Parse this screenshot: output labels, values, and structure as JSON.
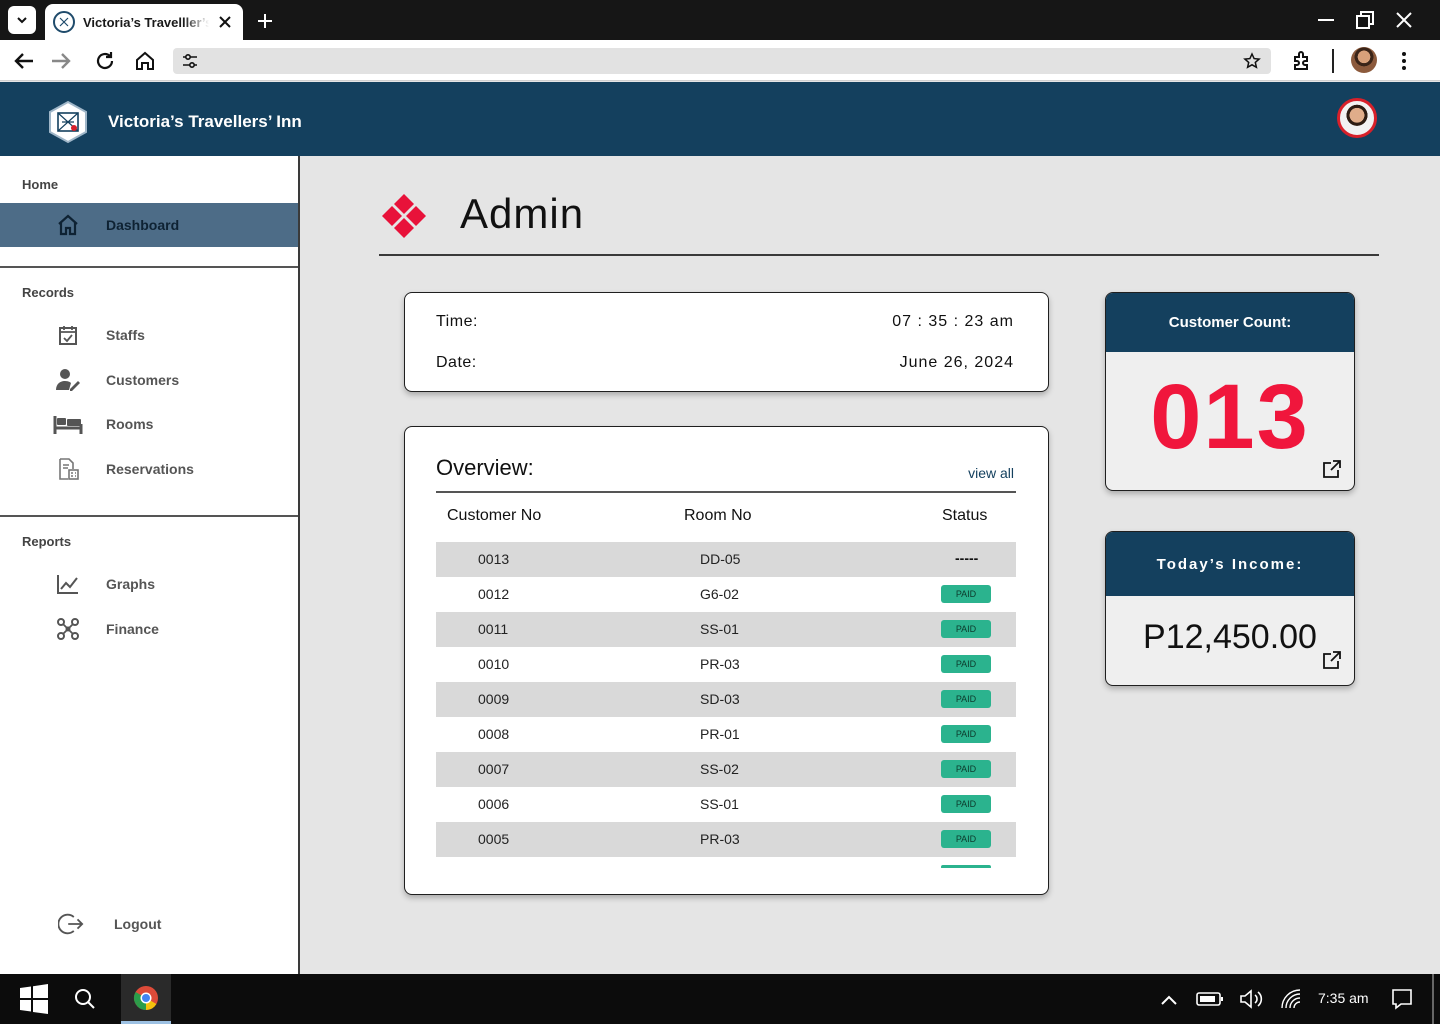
{
  "browser": {
    "tab_title": "Victoria’s Travelller’s",
    "url": ""
  },
  "header": {
    "app_title": "Victoria’s Travellers’ Inn"
  },
  "sidebar": {
    "home_section": "Home",
    "dashboard": "Dashboard",
    "records_section": "Records",
    "records": [
      "Staffs",
      "Customers",
      "Rooms",
      "Reservations"
    ],
    "reports_section": "Reports",
    "reports": [
      "Graphs",
      "Finance"
    ],
    "logout": "Logout"
  },
  "page": {
    "title": "Admin"
  },
  "datetime": {
    "time_label": "Time:",
    "time_value": "07 : 35 : 23 am",
    "date_label": "Date:",
    "date_value": "June 26, 2024"
  },
  "overview": {
    "title": "Overview:",
    "view_all": "view all",
    "columns": [
      "Customer No",
      "Room No",
      "Status"
    ],
    "rows": [
      {
        "customer": "0013",
        "room": "DD-05",
        "status": "-----"
      },
      {
        "customer": "0012",
        "room": "G6-02",
        "status": "PAID"
      },
      {
        "customer": "0011",
        "room": "SS-01",
        "status": "PAID"
      },
      {
        "customer": "0010",
        "room": "PR-03",
        "status": "PAID"
      },
      {
        "customer": "0009",
        "room": "SD-03",
        "status": "PAID"
      },
      {
        "customer": "0008",
        "room": "PR-01",
        "status": "PAID"
      },
      {
        "customer": "0007",
        "room": "SS-02",
        "status": "PAID"
      },
      {
        "customer": "0006",
        "room": "SS-01",
        "status": "PAID"
      },
      {
        "customer": "0005",
        "room": "PR-03",
        "status": "PAID"
      }
    ]
  },
  "stats": {
    "customer_count_label": "Customer Count:",
    "customer_count": "013",
    "income_label": "Today’s Income:",
    "income_value": "P12,450.00"
  },
  "taskbar": {
    "clock": "7:35 am"
  },
  "colors": {
    "header_bg": "#14405e",
    "accent_red": "#f0163c",
    "paid_badge": "#2bb38e",
    "sidebar_active": "#4d6c87"
  }
}
